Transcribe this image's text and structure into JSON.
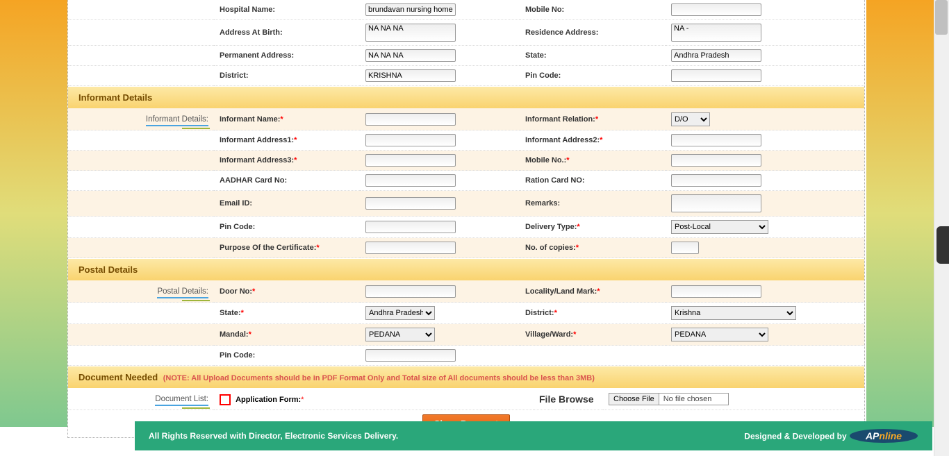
{
  "top_section": {
    "fields": [
      {
        "l1": "Hospital Name:",
        "v1": "brundavan nursing home",
        "type1": "text",
        "l2": "Mobile No:",
        "v2": "",
        "type2": "text"
      },
      {
        "l1": "Address At Birth:",
        "v1": "NA NA NA",
        "type1": "textarea",
        "l2": "Residence Address:",
        "v2": "NA -",
        "type2": "textarea"
      },
      {
        "l1": "Permanent Address:",
        "v1": "NA NA NA",
        "type1": "text",
        "l2": "State:",
        "v2": "Andhra Pradesh",
        "type2": "text"
      },
      {
        "l1": "District:",
        "v1": "KRISHNA",
        "type1": "text",
        "l2": "Pin Code:",
        "v2": "",
        "type2": "text"
      }
    ]
  },
  "sections": {
    "informant_header": "Informant Details",
    "postal_header": "Postal Details",
    "document_header": "Document Needed",
    "document_note": "(NOTE: All Upload Documents should be in PDF Format Only and Total size of All documents should be less than 3MB)"
  },
  "side_labels": {
    "informant": "Informant Details:",
    "postal": "Postal Details:",
    "doclist": "Document List:"
  },
  "informant": {
    "rows": [
      {
        "l1": "Informant Name:",
        "r1": true,
        "l2": "Informant Relation:",
        "r2": true,
        "type2": "select",
        "opts2": [
          "D/O"
        ]
      },
      {
        "l1": "Informant Address1:",
        "r1": true,
        "l2": "Informant Address2:",
        "r2": true
      },
      {
        "l1": "Informant Address3:",
        "r1": true,
        "l2": "Mobile No.:",
        "r2": true
      },
      {
        "l1": "AADHAR Card No:",
        "r1": false,
        "l2": "Ration Card NO:",
        "r2": false
      },
      {
        "l1": "Email ID:",
        "r1": false,
        "l2": "Remarks:",
        "r2": false,
        "type2": "textarea"
      },
      {
        "l1": "Pin Code:",
        "r1": false,
        "l2": "Delivery Type:",
        "r2": true,
        "type2": "select",
        "opts2": [
          "Post-Local"
        ],
        "wide2": true
      },
      {
        "l1": "Purpose Of the Certificate:",
        "r1": true,
        "l2": "No. of copies:",
        "r2": true,
        "narrow2": true
      }
    ]
  },
  "postal": {
    "rows": [
      {
        "l1": "Door No:",
        "r1": true,
        "l2": "Locality/Land Mark:",
        "r2": true
      },
      {
        "l1": "State:",
        "r1": true,
        "type1": "select",
        "opts1": [
          "Andhra Pradesh"
        ],
        "l2": "District:",
        "r2": true,
        "type2": "select",
        "opts2": [
          "Krishna"
        ],
        "wide2": true,
        "wider2": true
      },
      {
        "l1": "Mandal:",
        "r1": true,
        "type1": "select",
        "opts1": [
          "PEDANA"
        ],
        "l2": "Village/Ward:",
        "r2": true,
        "type2": "select",
        "opts2": [
          "PEDANA"
        ],
        "wide2": true
      },
      {
        "l1": "Pin Code:",
        "r1": false,
        "l2": "",
        "r2": false,
        "empty2": true
      }
    ]
  },
  "documents": {
    "app_form_label": "Application Form:",
    "file_browse_label": "File Browse",
    "choose_file_btn": "Choose File",
    "no_file": "No file chosen"
  },
  "buttons": {
    "show_payment": "Show Payment"
  },
  "footer": {
    "left": "All Rights Reserved with Director, Electronic Services Delivery.",
    "right": "Designed & Developed by",
    "logo_ap": "AP",
    "logo_online": "nline"
  }
}
